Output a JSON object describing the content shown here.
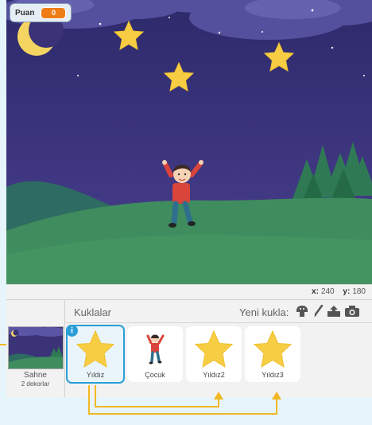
{
  "stage": {
    "variable_monitor": {
      "label": "Puan",
      "value": "0"
    }
  },
  "coords": {
    "x_label": "x:",
    "x_value": "240",
    "y_label": "y:",
    "y_value": "180"
  },
  "stage_thumb": {
    "label": "Sahne",
    "sub": "2 dekorlar"
  },
  "sprites_pane": {
    "title": "Kuklalar",
    "new_sprite_label": "Yeni kukla:",
    "new_sprite_icons": [
      "choose-from-library-icon",
      "paint-brush-icon",
      "upload-icon",
      "camera-icon"
    ]
  },
  "sprites": [
    {
      "name": "Yıldız",
      "selected": true,
      "thumb": "star"
    },
    {
      "name": "Çocuk",
      "selected": false,
      "thumb": "boy"
    },
    {
      "name": "Yıldız2",
      "selected": false,
      "thumb": "star"
    },
    {
      "name": "Yıldız3",
      "selected": false,
      "thumb": "star"
    }
  ],
  "colors": {
    "accent_orange": "#ee7d16",
    "selection_blue": "#2a9fd6",
    "arrow_yellow": "#f2b824"
  }
}
